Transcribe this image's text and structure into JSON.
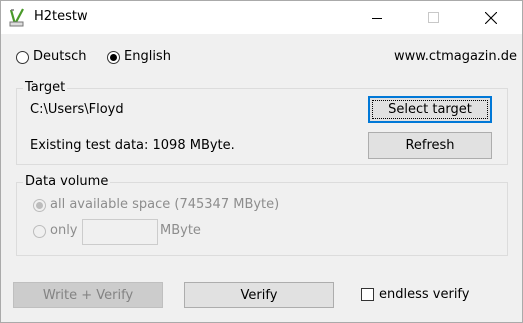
{
  "window": {
    "title": "H2testw"
  },
  "language": {
    "german_label": "Deutsch",
    "english_label": "English",
    "selected": "English",
    "website": "www.ctmagazin.de"
  },
  "target": {
    "group_title": "Target",
    "path": "C:\\Users\\Floyd",
    "existing_test_data": "Existing test data: 1098 MByte.",
    "select_button": "Select target",
    "refresh_button": "Refresh"
  },
  "data_volume": {
    "group_title": "Data volume",
    "all_space_label": "all available space (745347 MByte)",
    "only_label": "only",
    "only_value": "",
    "unit_label": "MByte"
  },
  "actions": {
    "write_verify_button": "Write + Verify",
    "verify_button": "Verify",
    "endless_verify_label": "endless verify",
    "endless_verify_checked": false
  },
  "icons": {
    "app": "h2testw-app-icon",
    "minimize": "minimize-icon",
    "maximize": "maximize-icon",
    "close": "close-icon"
  },
  "colors": {
    "default_button_border": "#0078d7",
    "disabled_text": "#8d8d8d"
  }
}
